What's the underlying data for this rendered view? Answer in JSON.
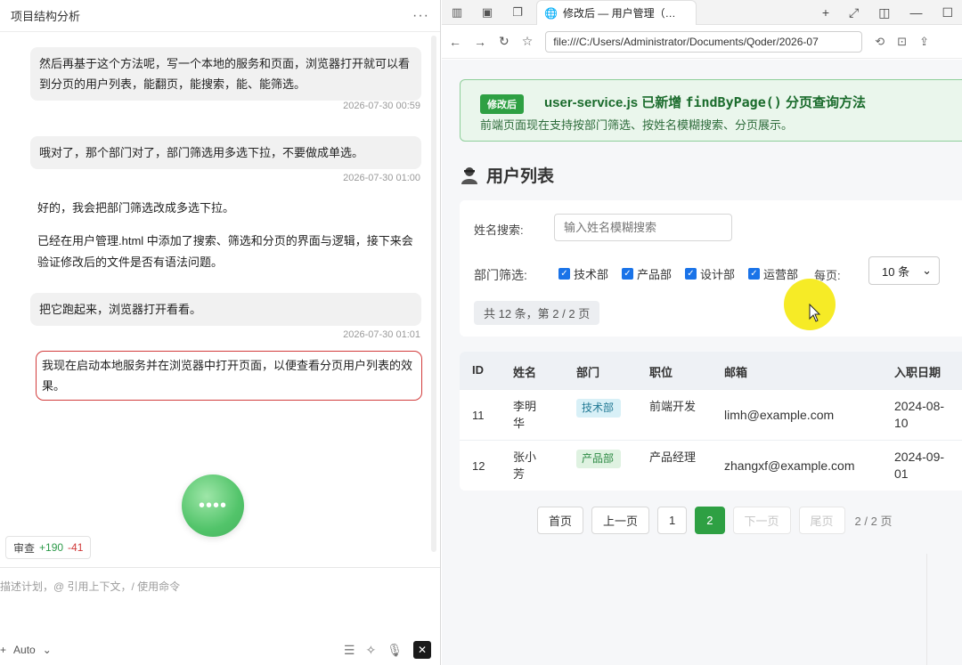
{
  "left_panel": {
    "title": "项目结构分析",
    "more": "···",
    "messages": [
      {
        "text": "然后再基于这个方法呢，写一个本地的服务和页面，浏览器打开就可以看到分页的用户列表，能翻页，能搜索，能、能筛选。",
        "time": "2026-07-30 00:59"
      },
      {
        "text": "哦对了，那个部门对了，部门筛选用多选下拉，不要做成单选。",
        "time": "2026-07-30 01:00"
      },
      {
        "text": "好的，我会把部门筛选改成多选下拉。"
      },
      {
        "text": "已经在用户管理.html 中添加了搜索、筛选和分页的界面与逻辑，接下来会验证修改后的文件是否有语法问题。"
      },
      {
        "text": "把它跑起来，浏览器打开看看。",
        "time": "2026-07-30 01:01"
      },
      {
        "text": "我现在启动本地服务并在浏览器中打开页面，以便查看分页用户列表的效果。"
      }
    ],
    "fab_dots": "••••",
    "review": {
      "label": "审查",
      "added": "+190",
      "removed": "-41"
    },
    "composer": {
      "placeholder": "描述计划，@ 引用上下文，/ 使用命令",
      "model": "Auto",
      "model_chevron": "⌄"
    }
  },
  "browser": {
    "tab_title": "修改后 — 用户管理（…",
    "url": "file:///C:/Users/Administrator/Documents/Qoder/2026-07",
    "icons": {
      "back": "back-icon",
      "forward": "forward-icon",
      "reload": "reload-icon",
      "star": "star-icon"
    }
  },
  "page": {
    "notice": {
      "badge": "修改后",
      "file": "user-service.js",
      "added_text": "已新增",
      "method": "findByPage()",
      "method_desc": "分页查询方法",
      "subtitle": "前端页面现在支持按部门筛选、按姓名模糊搜索、分页展示。"
    },
    "title": "用户列表",
    "filter": {
      "search_label": "姓名搜索:",
      "search_placeholder": "输入姓名模糊搜索",
      "dept_label": "部门筛选:",
      "departments": [
        {
          "label": "技术部",
          "checked": true
        },
        {
          "label": "产品部",
          "checked": true
        },
        {
          "label": "设计部",
          "checked": true
        },
        {
          "label": "运营部",
          "checked": true
        }
      ],
      "perpage_label": "每页:",
      "perpage_value": "10 条",
      "count_text": "共 12 条，第 2 / 2 页"
    },
    "table": {
      "headers": [
        "ID",
        "姓名",
        "部门",
        "职位",
        "邮箱",
        "入职日期"
      ],
      "rows": [
        {
          "id": "11",
          "name": "李明华",
          "dept": "技术部",
          "position": "前端开发",
          "email": "limh@example.com",
          "date": "2024-08-10"
        },
        {
          "id": "12",
          "name": "张小芳",
          "dept": "产品部",
          "position": "产品经理",
          "email": "zhangxf@example.com",
          "date": "2024-09-01"
        }
      ]
    },
    "pager": {
      "first": "首页",
      "prev": "上一页",
      "pages": [
        "1",
        "2"
      ],
      "current": "2",
      "next": "下一页",
      "last": "尾页",
      "info": "2 / 2 页"
    }
  },
  "colors": {
    "accent_green": "#2ea043",
    "highlight_red": "#d23c3c",
    "cursor_yellow": "#f5ea1a"
  }
}
